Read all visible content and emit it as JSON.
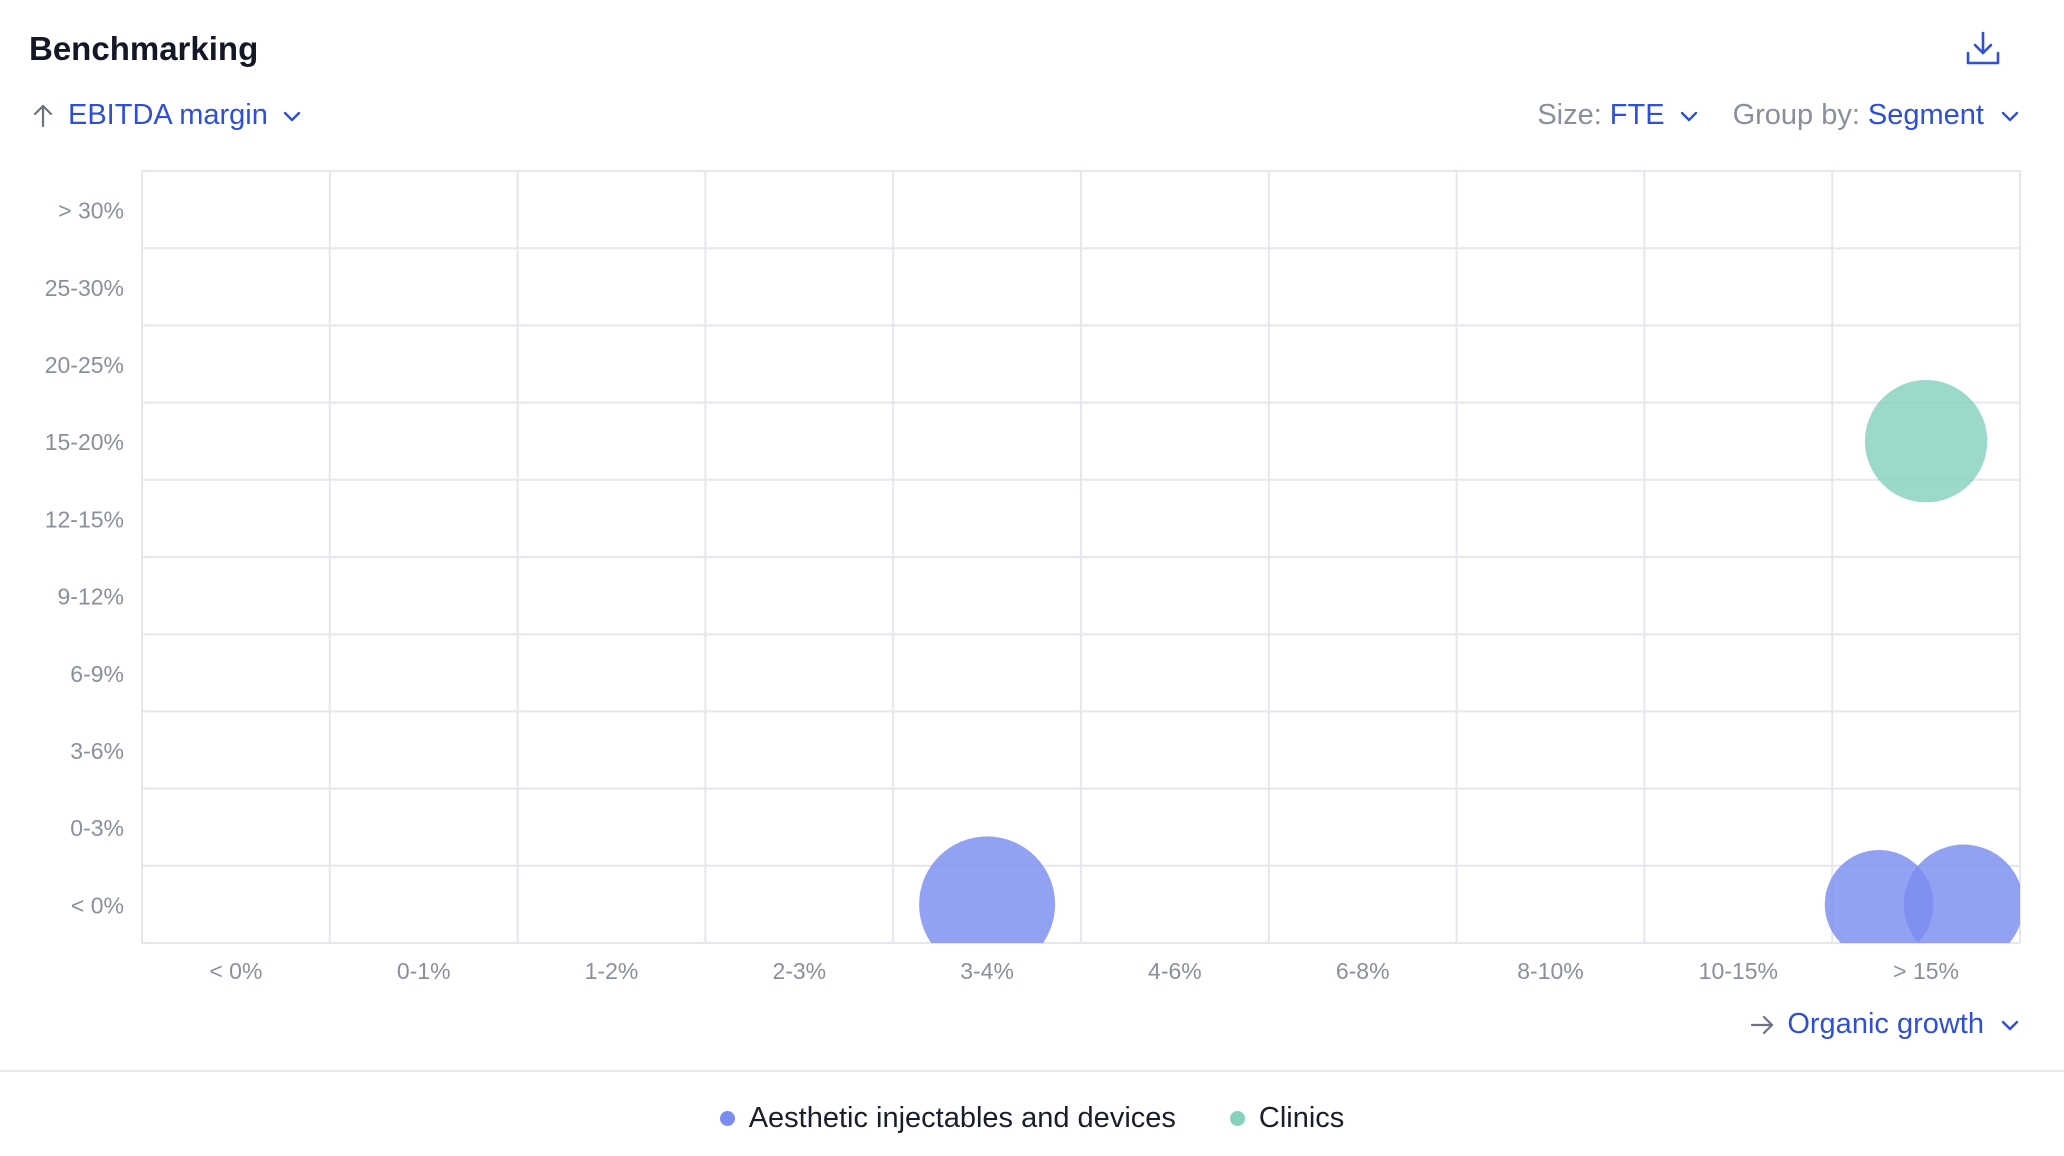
{
  "header": {
    "title": "Benchmarking",
    "download_icon": "download-icon"
  },
  "controls": {
    "y_metric": "EBITDA margin",
    "size_label": "Size:",
    "size_value": "FTE",
    "group_label": "Group by:",
    "group_value": "Segment",
    "x_metric": "Organic growth"
  },
  "colors": {
    "accent": "#2f4fd6",
    "series_1": "#7b8cf0",
    "series_2": "#86d1be",
    "grid": "#e4e7ed"
  },
  "chart_data": {
    "type": "scatter",
    "title": "",
    "xlabel": "Organic growth",
    "ylabel": "EBITDA margin",
    "x_categories": [
      "< 0%",
      "0-1%",
      "1-2%",
      "2-3%",
      "3-4%",
      "4-6%",
      "6-8%",
      "8-10%",
      "10-15%",
      "> 15%"
    ],
    "y_categories": [
      "< 0%",
      "0-3%",
      "3-6%",
      "6-9%",
      "9-12%",
      "12-15%",
      "15-20%",
      "20-25%",
      "25-30%",
      "> 30%"
    ],
    "grid": true,
    "legend_position": "bottom-center",
    "series": [
      {
        "name": "Aesthetic injectables and devices",
        "color": "#7b8cf0",
        "points": [
          {
            "x": "3-4%",
            "y": "< 0%",
            "size": 1.0
          },
          {
            "x": "> 15%",
            "y": "< 0%",
            "size": 0.8,
            "offset": -0.25
          },
          {
            "x": "> 15%",
            "y": "< 0%",
            "size": 0.88,
            "offset": 0.2
          }
        ]
      },
      {
        "name": "Clinics",
        "color": "#86d1be",
        "points": [
          {
            "x": "> 15%",
            "y": "15-20%",
            "size": 0.9
          }
        ]
      }
    ]
  }
}
